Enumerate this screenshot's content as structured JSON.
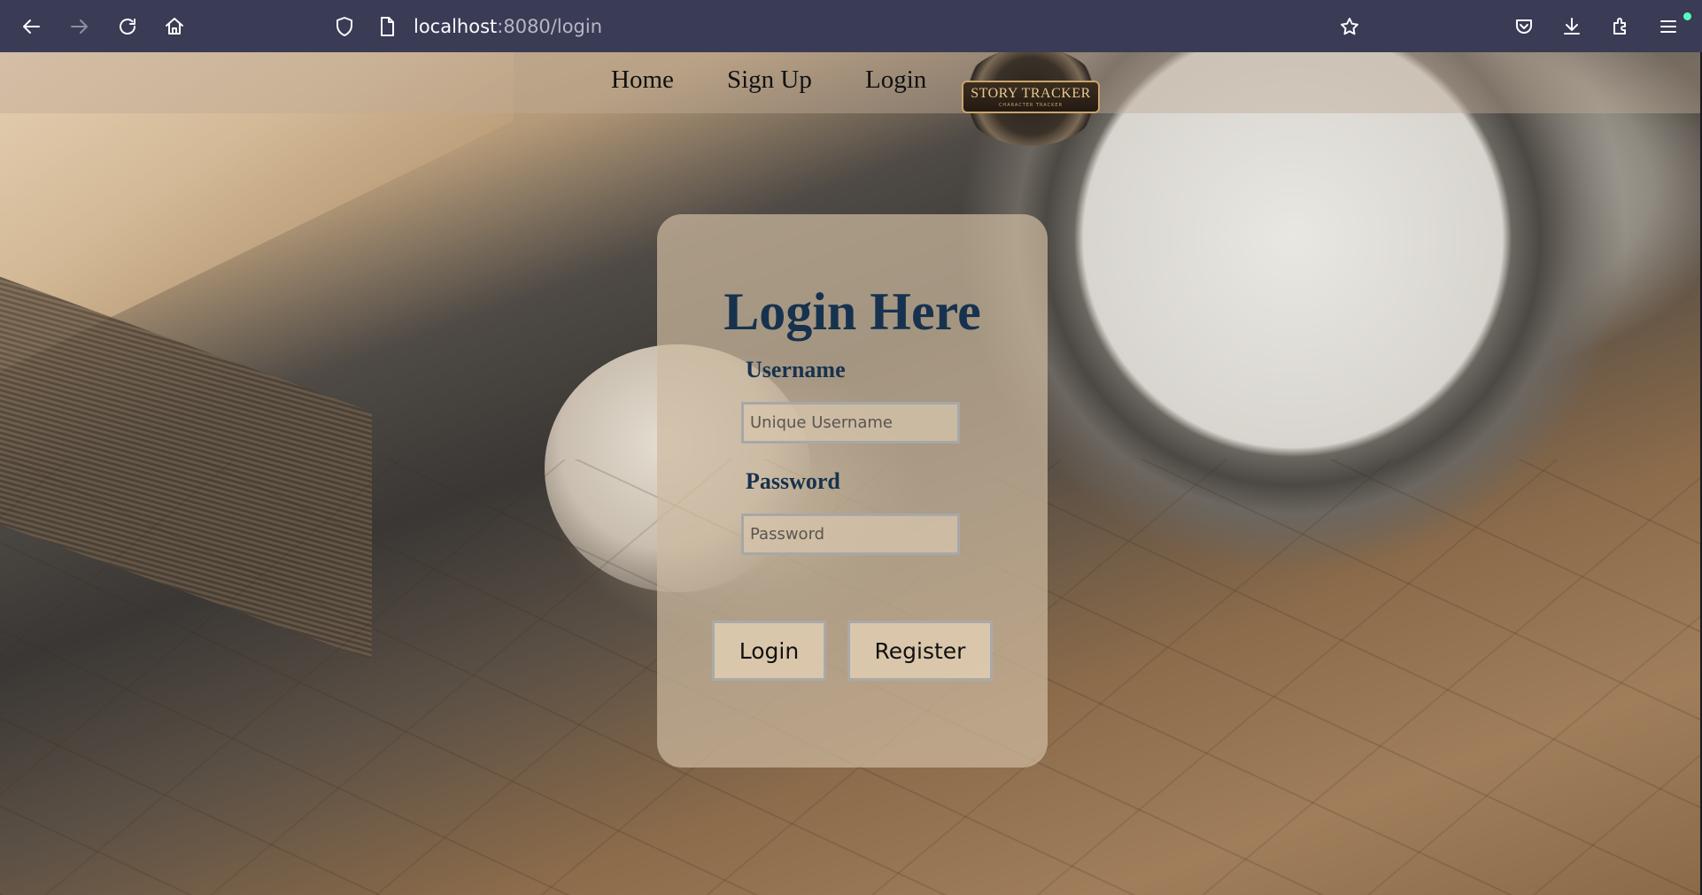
{
  "browser": {
    "url_host": "localhost",
    "url_rest": ":8080/login",
    "icons": [
      "back-icon",
      "forward-icon",
      "reload-icon",
      "home-icon",
      "shield-icon",
      "page-icon",
      "bookmark-star-icon",
      "pocket-icon",
      "download-icon",
      "extensions-icon",
      "menu-icon"
    ]
  },
  "nav": {
    "home": "Home",
    "signup": "Sign Up",
    "login": "Login",
    "logo_text": "STORY TRACKER",
    "logo_sub": "CHARACTER TRACKER"
  },
  "login_card": {
    "title": "Login Here",
    "username_label": "Username",
    "username_placeholder": "Unique Username",
    "password_label": "Password",
    "password_placeholder": "Password",
    "login_button": "Login",
    "register_button": "Register"
  }
}
